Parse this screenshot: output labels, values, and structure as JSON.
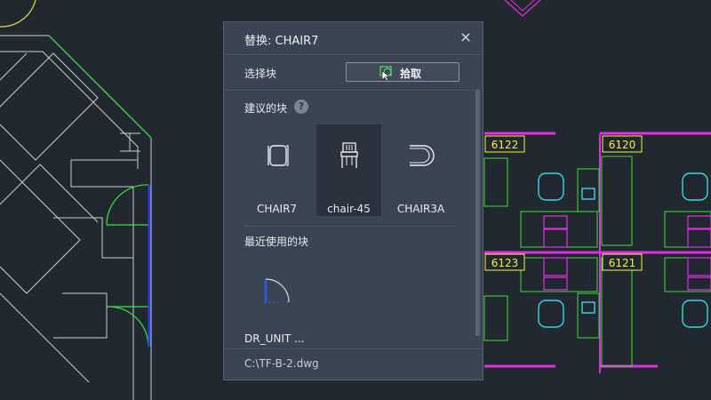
{
  "dialog": {
    "title": "替换: CHAIR7",
    "close_label": "×",
    "select_block_label": "选择块",
    "pick_button_label": "拾取",
    "suggested_label": "建议的块",
    "help_label": "?",
    "suggested_blocks": [
      {
        "name": "CHAIR7",
        "icon": "chair7-block-icon",
        "selected": false
      },
      {
        "name": "chair-45",
        "icon": "chair-45-block-icon",
        "selected": true
      },
      {
        "name": "CHAIR3A",
        "icon": "chair3a-block-icon",
        "selected": false
      }
    ],
    "recent_label": "最近使用的块",
    "recent_blocks": [
      {
        "name": "DR_UNIT ...",
        "icon": "door-unit-block-icon"
      }
    ],
    "file_path": "C:\\TF-B-2.dwg"
  },
  "drawing": {
    "room_labels": [
      "6122",
      "6120",
      "6123",
      "6121"
    ]
  },
  "colors": {
    "background": "#212830",
    "dialog": "#3b4453",
    "wall": "#c8ccd2",
    "door": "#39e639",
    "magenta": "#e22ee2",
    "cyan": "#38d8e0",
    "green": "#3cde3c",
    "label_yellow": "#f5f542"
  }
}
